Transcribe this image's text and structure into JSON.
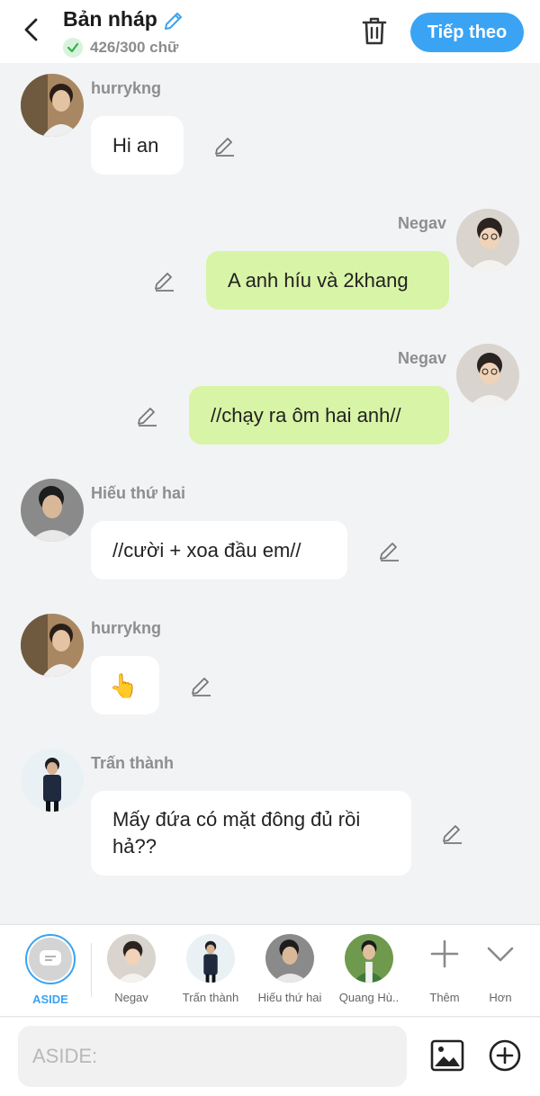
{
  "header": {
    "title": "Bản nháp",
    "word_count": "426/300 chữ",
    "next_label": "Tiếp theo"
  },
  "messages": [
    {
      "name": "hurrykng",
      "text": "Hi an",
      "side": "left"
    },
    {
      "name": "Negav",
      "text": "A anh híu và 2khang",
      "side": "right"
    },
    {
      "name": "Negav",
      "text": "//chạy ra ôm hai anh//",
      "side": "right"
    },
    {
      "name": "Hiếu thứ hai",
      "text": "//cười + xoa đầu em//",
      "side": "left"
    },
    {
      "name": "hurrykng",
      "text": "👆",
      "side": "left"
    },
    {
      "name": "Trấn thành",
      "text": "Mấy đứa có mặt đông đủ rồi hả??",
      "side": "left"
    }
  ],
  "characters": [
    {
      "label": "ASIDE",
      "selected": true
    },
    {
      "label": "Negav"
    },
    {
      "label": "Trấn thành"
    },
    {
      "label": "Hiếu thứ hai"
    },
    {
      "label": "Quang Hù.."
    }
  ],
  "actions": {
    "more_label": "Thêm",
    "expand_label": "Hơn"
  },
  "input": {
    "placeholder": "ASIDE:"
  },
  "colors": {
    "accent": "#3aa3f3",
    "own_bubble": "#d8f4a6",
    "other_bubble": "#ffffff",
    "background": "#f2f3f5"
  }
}
